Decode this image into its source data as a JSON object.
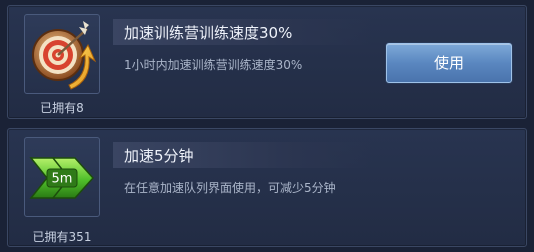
{
  "items": [
    {
      "icon": "target-arrow-speedup-icon",
      "title": "加速训练营训练速度30%",
      "description": "1小时内加速训练营训练速度30%",
      "owned": "已拥有8",
      "button_label": "使用"
    },
    {
      "icon": "5m-speedup-arrows-icon",
      "icon_text": "5m",
      "title": "加速5分钟",
      "description": "在任意加速队列界面使用，可减少5分钟",
      "owned": "已拥有351"
    }
  ],
  "colors": {
    "background": "#1a2236",
    "panel": "#263250",
    "button": "#5a87c0",
    "title_text": "#eef2fa",
    "desc_text": "#aab5c9"
  }
}
